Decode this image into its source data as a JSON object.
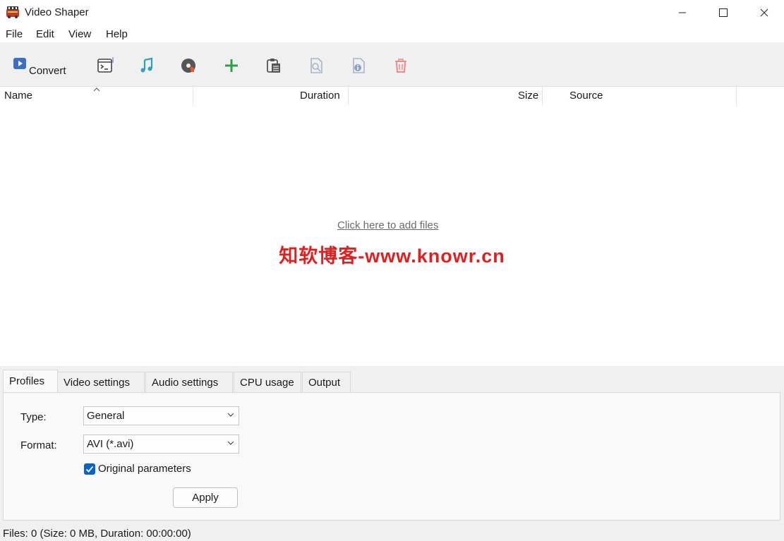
{
  "window": {
    "title": "Video Shaper"
  },
  "menu": {
    "items": [
      "File",
      "Edit",
      "View",
      "Help"
    ]
  },
  "toolbar": {
    "convert_label": "Convert",
    "icons": [
      "convert-icon",
      "terminal-icon",
      "music-icon",
      "disc-icon",
      "add-icon",
      "paste-icon",
      "preview-icon",
      "info-icon",
      "delete-icon"
    ]
  },
  "list": {
    "columns": [
      "Name",
      "Duration",
      "Size",
      "Source"
    ],
    "empty_link": "Click here to add files",
    "watermark": "知软博客-www.knowr.cn"
  },
  "tabs": [
    "Profiles",
    "Video settings",
    "Audio settings",
    "CPU usage",
    "Output"
  ],
  "profiles": {
    "type_label": "Type:",
    "type_value": "General",
    "format_label": "Format:",
    "format_value": "AVI (*.avi)",
    "original_params_label": "Original parameters",
    "original_params_checked": true,
    "apply_label": "Apply"
  },
  "status": {
    "text": "Files: 0 (Size: 0 MB, Duration: 00:00:00)"
  },
  "colors": {
    "accent": "#0a63c9",
    "watermark": "#e02020",
    "add": "#2ea043"
  }
}
